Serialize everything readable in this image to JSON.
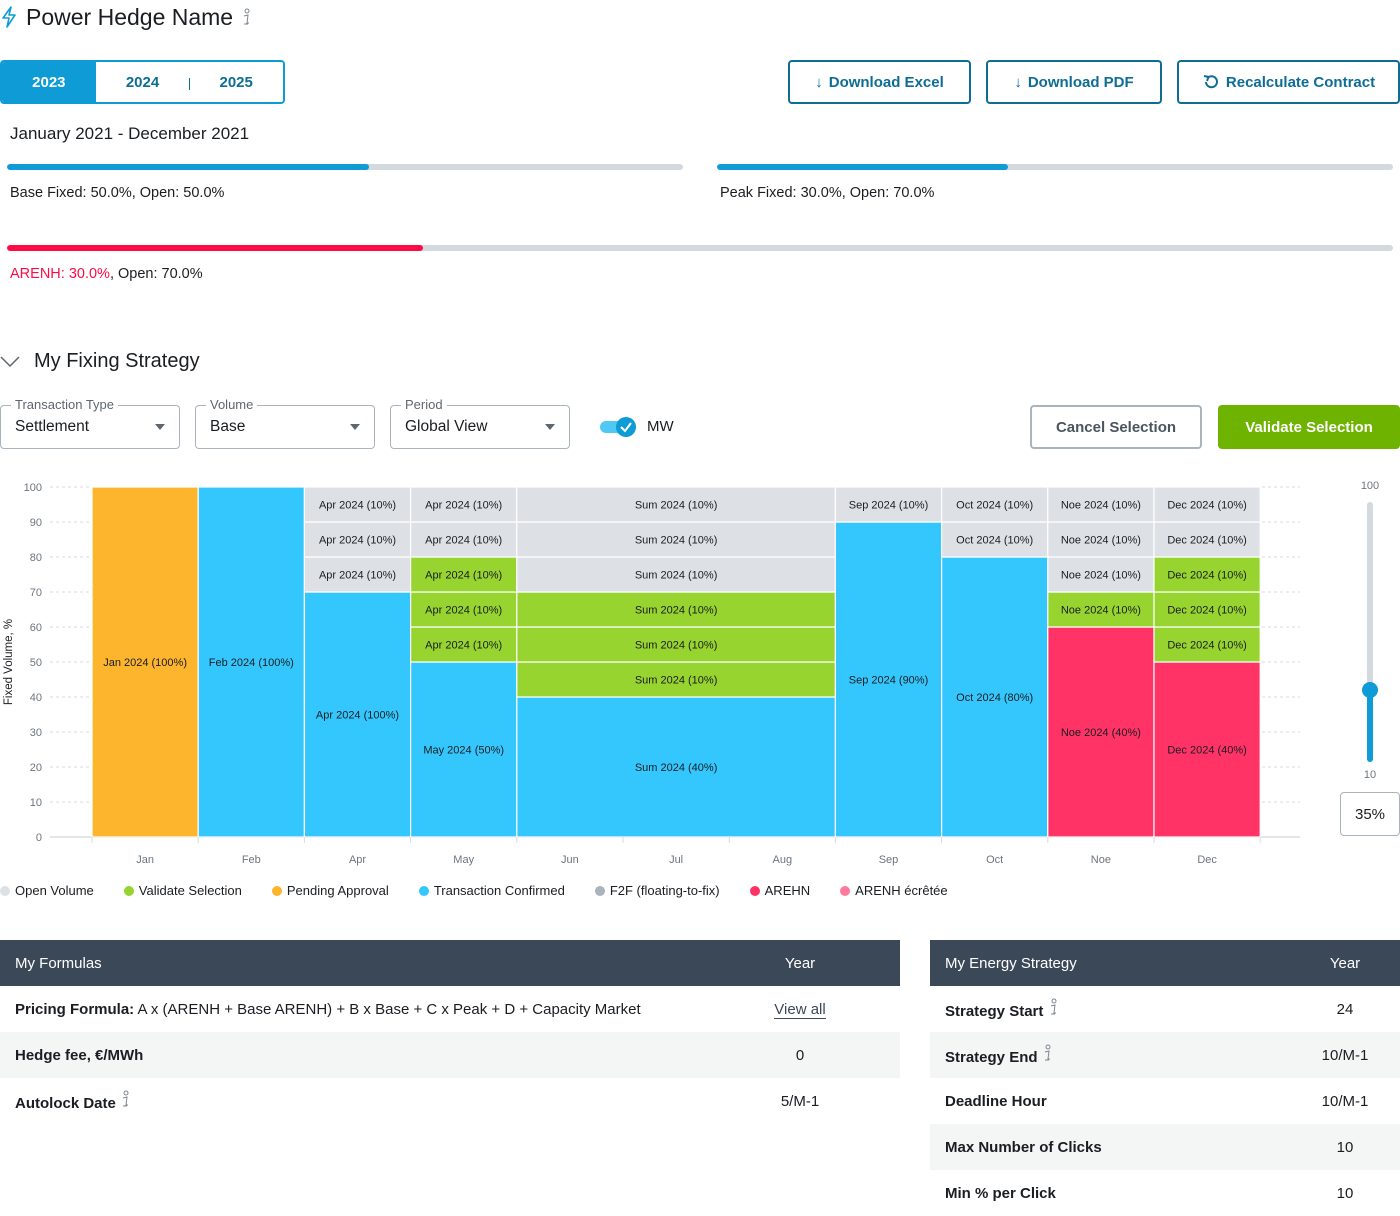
{
  "header": {
    "title": "Power Hedge Name",
    "icon": "bolt-icon"
  },
  "year_tabs": [
    {
      "label": "2023",
      "active": true
    },
    {
      "label": "2024",
      "active": false
    },
    {
      "label": "2025",
      "active": false
    }
  ],
  "toolbar": {
    "download_excel": "Download Excel",
    "download_pdf": "Download PDF",
    "recalculate": "Recalculate Contract"
  },
  "period_label": "January 2021 - December 2021",
  "progress": {
    "base": {
      "label": "Base Fixed: 50.0%, Open: 50.0%",
      "fixed": 0.535,
      "color": "#0e9bd6"
    },
    "peak": {
      "label": "Peak Fixed: 30.0%, Open: 70.0%",
      "fixed": 0.43,
      "color": "#0e9bd6"
    },
    "arenh": {
      "label_red": "ARENH: 30.0%",
      "label_rest": ", Open: 70.0%",
      "fixed": 0.3,
      "color": "#ff0a45"
    }
  },
  "section": {
    "title": "My Fixing Strategy"
  },
  "filters": {
    "transaction_type": {
      "label": "Transaction Type",
      "value": "Settlement"
    },
    "volume": {
      "label": "Volume",
      "value": "Base"
    },
    "period": {
      "label": "Period",
      "value": "Global View"
    },
    "mw_toggle": {
      "label": "MW",
      "on": true
    }
  },
  "actions": {
    "cancel": "Cancel Selection",
    "validate": "Validate Selection"
  },
  "slider": {
    "max": "100",
    "min": "10",
    "value": 35,
    "value_label": "35%"
  },
  "colors": {
    "open": "#dde1e5",
    "validate": "#97d42f",
    "pending": "#fdb52e",
    "confirmed": "#33c7fd",
    "f2f": "#a9b4bd",
    "arenh": "#ff3366",
    "arenh_ecretee": "#ff7a9a"
  },
  "chart_data": {
    "type": "bar",
    "stacked": true,
    "ylabel": "Fixed Volume, %",
    "ylim": [
      0,
      100
    ],
    "yticks": [
      0,
      10,
      20,
      30,
      40,
      50,
      60,
      70,
      80,
      90,
      100
    ],
    "grid": true,
    "x_ticks": [
      "Jan",
      "Feb",
      "Apr",
      "May",
      "Jun",
      "Jul",
      "Aug",
      "Sep",
      "Oct",
      "Noe",
      "Dec"
    ],
    "columns": [
      {
        "span": 1,
        "segments": [
          {
            "label": "Jan 2024 (100%)",
            "value": 100,
            "status": "pending"
          }
        ]
      },
      {
        "span": 1,
        "segments": [
          {
            "label": "Feb 2024 (100%)",
            "value": 100,
            "status": "confirmed"
          }
        ]
      },
      {
        "span": 1,
        "segments": [
          {
            "label": "Apr 2024 (100%)",
            "value": 70,
            "status": "confirmed"
          },
          {
            "label": "Apr 2024 (10%)",
            "value": 10,
            "status": "open"
          },
          {
            "label": "Apr 2024 (10%)",
            "value": 10,
            "status": "open"
          },
          {
            "label": "Apr 2024 (10%)",
            "value": 10,
            "status": "open"
          }
        ]
      },
      {
        "span": 1,
        "segments": [
          {
            "label": "May 2024 (50%)",
            "value": 50,
            "status": "confirmed"
          },
          {
            "label": "Apr 2024 (10%)",
            "value": 10,
            "status": "validate"
          },
          {
            "label": "Apr 2024 (10%)",
            "value": 10,
            "status": "validate"
          },
          {
            "label": "Apr 2024 (10%)",
            "value": 10,
            "status": "validate"
          },
          {
            "label": "Apr 2024 (10%)",
            "value": 10,
            "status": "open"
          },
          {
            "label": "Apr 2024 (10%)",
            "value": 10,
            "status": "open"
          }
        ]
      },
      {
        "span": 3,
        "segments": [
          {
            "label": "Sum 2024 (40%)",
            "value": 40,
            "status": "confirmed"
          },
          {
            "label": "Sum 2024 (10%)",
            "value": 10,
            "status": "validate"
          },
          {
            "label": "Sum 2024 (10%)",
            "value": 10,
            "status": "validate"
          },
          {
            "label": "Sum 2024 (10%)",
            "value": 10,
            "status": "validate"
          },
          {
            "label": "Sum 2024 (10%)",
            "value": 10,
            "status": "open"
          },
          {
            "label": "Sum 2024 (10%)",
            "value": 10,
            "status": "open"
          },
          {
            "label": "Sum 2024 (10%)",
            "value": 10,
            "status": "open"
          }
        ]
      },
      {
        "span": 1,
        "segments": [
          {
            "label": "Sep 2024 (90%)",
            "value": 90,
            "status": "confirmed"
          },
          {
            "label": "Sep 2024 (10%)",
            "value": 10,
            "status": "open"
          }
        ]
      },
      {
        "span": 1,
        "segments": [
          {
            "label": "Oct 2024 (80%)",
            "value": 80,
            "status": "confirmed"
          },
          {
            "label": "Oct 2024 (10%)",
            "value": 10,
            "status": "open"
          },
          {
            "label": "Oct 2024 (10%)",
            "value": 10,
            "status": "open"
          }
        ]
      },
      {
        "span": 1,
        "segments": [
          {
            "label": "Noe 2024 (40%)",
            "value": 60,
            "status": "arenh"
          },
          {
            "label": "Noe 2024 (10%)",
            "value": 10,
            "status": "validate"
          },
          {
            "label": "Noe 2024 (10%)",
            "value": 10,
            "status": "open"
          },
          {
            "label": "Noe 2024 (10%)",
            "value": 10,
            "status": "open"
          },
          {
            "label": "Noe 2024 (10%)",
            "value": 10,
            "status": "open"
          }
        ]
      },
      {
        "span": 1,
        "segments": [
          {
            "label": "Dec 2024 (40%)",
            "value": 50,
            "status": "arenh"
          },
          {
            "label": "Dec 2024 (10%)",
            "value": 10,
            "status": "validate"
          },
          {
            "label": "Dec 2024 (10%)",
            "value": 10,
            "status": "validate"
          },
          {
            "label": "Dec 2024 (10%)",
            "value": 10,
            "status": "validate"
          },
          {
            "label": "Dec 2024 (10%)",
            "value": 10,
            "status": "open"
          },
          {
            "label": "Dec 2024 (10%)",
            "value": 10,
            "status": "open"
          }
        ]
      }
    ],
    "legend": [
      {
        "label": "Open Volume",
        "status": "open"
      },
      {
        "label": "Validate Selection",
        "status": "validate"
      },
      {
        "label": "Pending Approval",
        "status": "pending"
      },
      {
        "label": "Transaction Confirmed",
        "status": "confirmed"
      },
      {
        "label": "F2F (floating-to-fix)",
        "status": "f2f"
      },
      {
        "label": "AREHN",
        "status": "arenh"
      },
      {
        "label": "ARENH écrêtée",
        "status": "arenh_ecretee"
      }
    ]
  },
  "formulas": {
    "header": {
      "title": "My Formulas",
      "year": "Year"
    },
    "pricing": {
      "label": "Pricing Formula:",
      "formula": " A x (ARENH + Base ARENH) + B x Base + C x Peak + D + Capacity Market",
      "link": "View all"
    },
    "rows": [
      {
        "label": "Hedge fee, €/MWh",
        "value": "0",
        "info": false
      },
      {
        "label": "Autolock Date",
        "value": "5/M-1",
        "info": true
      }
    ]
  },
  "energy": {
    "header": {
      "title": "My Energy Strategy",
      "year": "Year"
    },
    "rows": [
      {
        "label": "Strategy Start",
        "value": "24",
        "info": true
      },
      {
        "label": "Strategy End",
        "value": "10/M-1",
        "info": true
      },
      {
        "label": "Deadline Hour",
        "value": "10/M-1",
        "info": false
      },
      {
        "label": "Max Number of Clicks",
        "value": "10",
        "info": false
      },
      {
        "label": "Min % per Click",
        "value": "10",
        "info": false
      }
    ]
  }
}
